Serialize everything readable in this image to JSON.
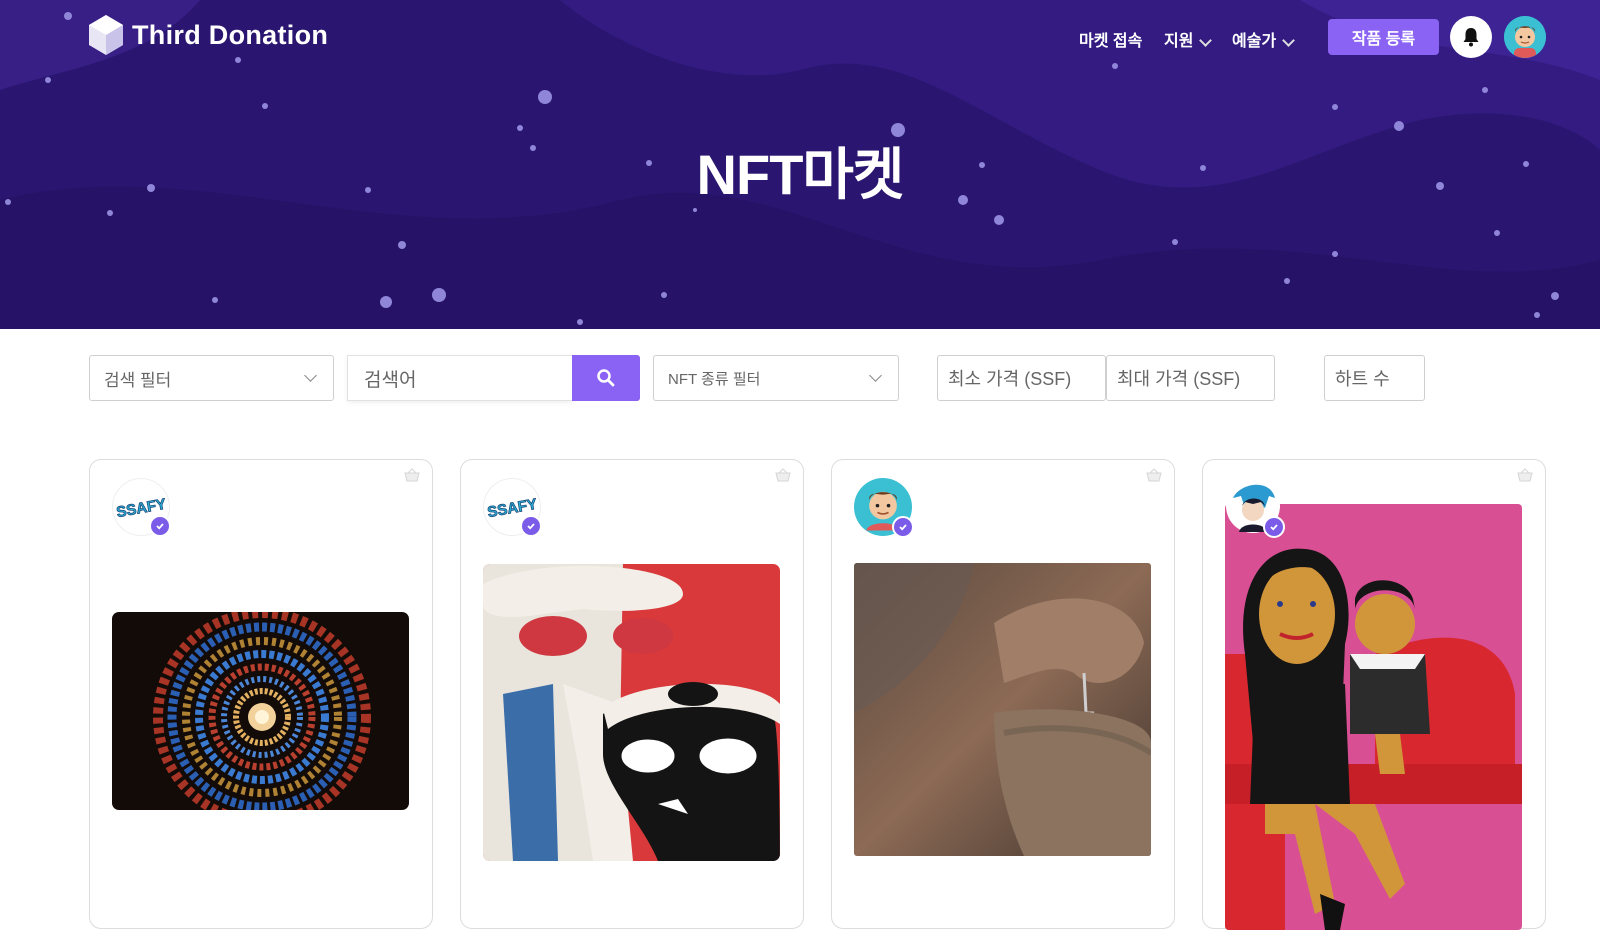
{
  "brand": {
    "name": "Third Donation"
  },
  "nav": {
    "items": [
      {
        "label": "마켓 접속",
        "dropdown": false
      },
      {
        "label": "지원",
        "dropdown": true
      },
      {
        "label": "예술가",
        "dropdown": true
      }
    ],
    "register_label": "작품 등록"
  },
  "hero": {
    "title": "NFT마켓"
  },
  "filters": {
    "search_filter": "검색 필터",
    "search_placeholder": "검색어",
    "nft_type_filter": "NFT 종류 필터",
    "min_price": "최소 가격 (SSF)",
    "max_price": "최대 가격 (SSF)",
    "hearts": "하트 수"
  },
  "cards": [
    {
      "owner_avatar": "ssafy-logo",
      "verified": true,
      "image": "stained-glass-spiral"
    },
    {
      "owner_avatar": "ssafy-logo",
      "verified": true,
      "image": "cats-with-sunglasses-painting"
    },
    {
      "owner_avatar": "cartoon-man",
      "verified": true,
      "image": "hand-crafting-clay"
    },
    {
      "owner_avatar": "anime-character",
      "verified": true,
      "image": "mother-daughter-painting"
    }
  ],
  "colors": {
    "hero_bg": "#2a1670",
    "accent": "#8a63f5",
    "verify": "#7b5ce8"
  }
}
